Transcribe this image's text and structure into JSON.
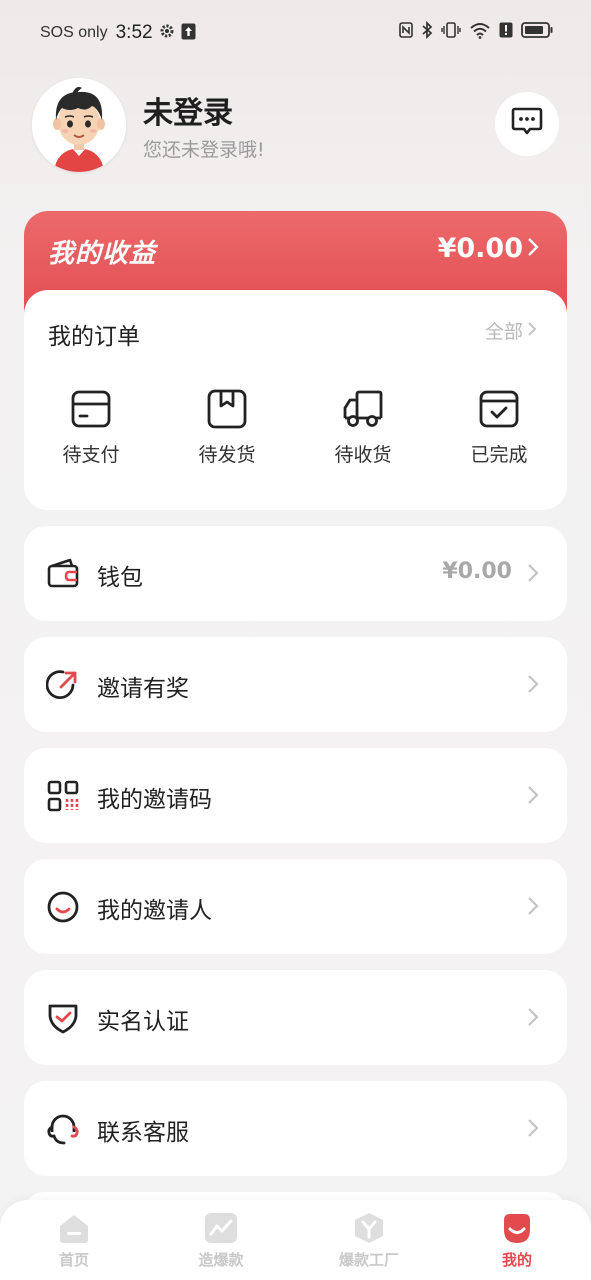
{
  "status_bar": {
    "carrier": "SOS only",
    "time": "3:52"
  },
  "profile": {
    "name": "未登录",
    "subtitle": "您还未登录哦!"
  },
  "earnings": {
    "title": "我的收益",
    "amount": "¥0.00"
  },
  "orders": {
    "title": "我的订单",
    "all_label": "全部",
    "items": [
      {
        "label": "待支付",
        "icon": "card-icon"
      },
      {
        "label": "待发货",
        "icon": "box-icon"
      },
      {
        "label": "待收货",
        "icon": "truck-icon"
      },
      {
        "label": "已完成",
        "icon": "check-box-icon"
      }
    ]
  },
  "menu": [
    {
      "label": "钱包",
      "value": "¥0.00",
      "icon": "wallet-icon"
    },
    {
      "label": "邀请有奖",
      "icon": "invite-arrow-icon"
    },
    {
      "label": "我的邀请码",
      "icon": "qr-code-icon"
    },
    {
      "label": "我的邀请人",
      "icon": "smile-icon"
    },
    {
      "label": "实名认证",
      "icon": "shield-check-icon"
    },
    {
      "label": "联系客服",
      "icon": "headset-icon"
    }
  ],
  "bottom_nav": [
    {
      "label": "首页",
      "icon": "home-icon"
    },
    {
      "label": "造爆款",
      "icon": "trend-icon"
    },
    {
      "label": "爆款工厂",
      "icon": "factory-icon"
    },
    {
      "label": "我的",
      "icon": "me-icon",
      "active": true
    }
  ],
  "colors": {
    "accent": "#e24a4e",
    "background": "#f4f3f3"
  }
}
